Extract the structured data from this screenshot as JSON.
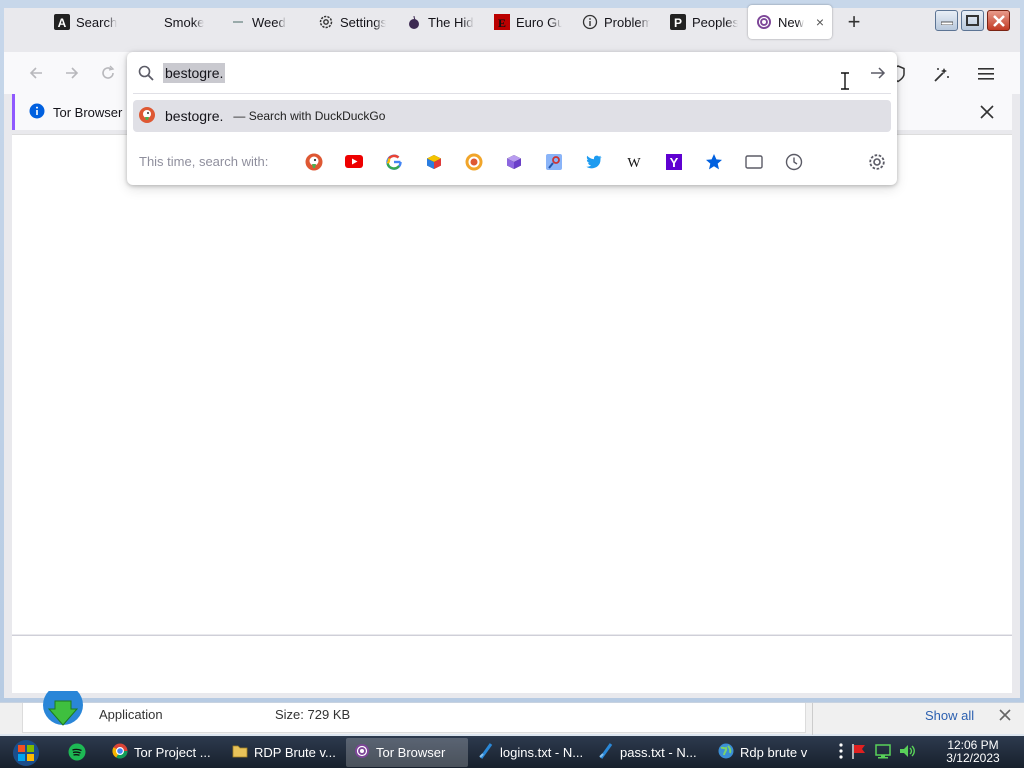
{
  "browser": {
    "tabs": [
      {
        "label": "Search",
        "icon": "a-logo-icon"
      },
      {
        "label": "Smoke",
        "icon": "blank-icon"
      },
      {
        "label": "Weed",
        "icon": "dash-icon"
      },
      {
        "label": "Settings",
        "icon": "gear-icon"
      },
      {
        "label": "The Hid",
        "icon": "onion-icon"
      },
      {
        "label": "Euro Gu",
        "icon": "e-logo-icon"
      },
      {
        "label": "Problem",
        "icon": "info-icon"
      },
      {
        "label": "Peoples",
        "icon": "p-logo-icon"
      },
      {
        "label": "New",
        "icon": "tor-icon",
        "active": true
      }
    ],
    "infobar_text": "Tor Browser"
  },
  "urlbar": {
    "value": "bestogre.",
    "suggestion_title": "bestogre.",
    "suggestion_action": "— Search with DuckDuckGo",
    "oneoff_label": "This time, search with:",
    "engines": [
      "duckduckgo",
      "youtube",
      "google",
      "cube-1",
      "duckduckgo-onion",
      "cube-2",
      "image-search",
      "twitter",
      "wikipedia",
      "yahoo",
      "bookmarks",
      "tabs",
      "history"
    ]
  },
  "download": {
    "type_label": "Application",
    "size_label": "Size:  729 KB",
    "show_all": "Show all"
  },
  "taskbar": {
    "items": [
      {
        "label": "Tor Project ...",
        "icon": "chrome-icon"
      },
      {
        "label": "RDP Brute v...",
        "icon": "folder-icon"
      },
      {
        "label": "Tor Browser",
        "icon": "tor-icon",
        "active": true
      },
      {
        "label": "logins.txt - N...",
        "icon": "notepad-icon"
      },
      {
        "label": "pass.txt - N...",
        "icon": "notepad-icon"
      },
      {
        "label": "Rdp brute v",
        "icon": "globe-icon"
      }
    ],
    "time": "12:06 PM",
    "date": "3/12/2023"
  }
}
